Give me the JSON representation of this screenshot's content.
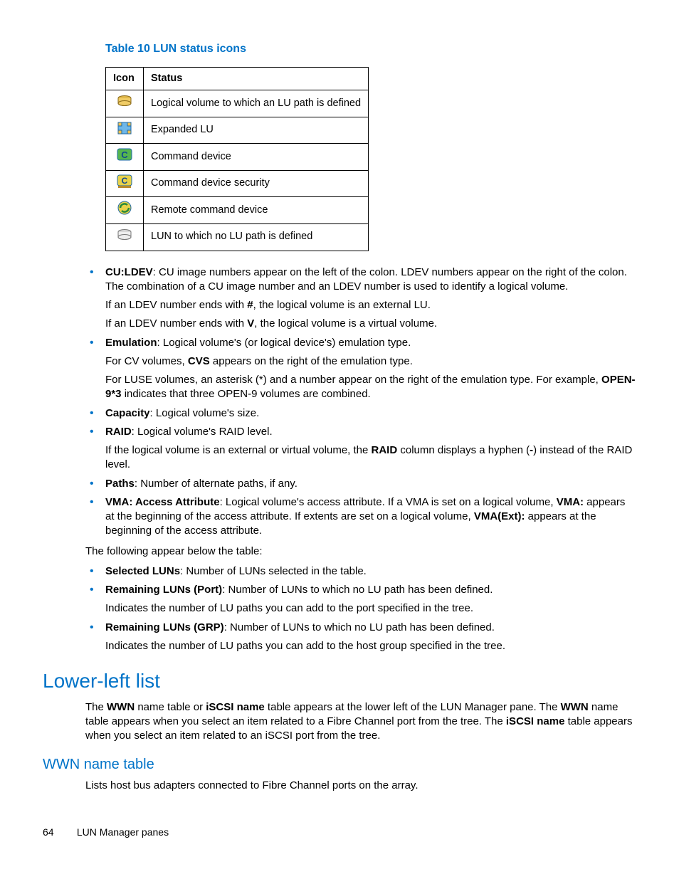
{
  "tableTitle": "Table 10 LUN status icons",
  "tableHeaders": {
    "icon": "Icon",
    "status": "Status"
  },
  "tableRows": [
    {
      "iconName": "lun-defined-icon",
      "status": "Logical volume to which an LU path is defined"
    },
    {
      "iconName": "expanded-lu-icon",
      "status": "Expanded LU"
    },
    {
      "iconName": "command-device-icon",
      "status": "Command device"
    },
    {
      "iconName": "command-device-security-icon",
      "status": "Command device security"
    },
    {
      "iconName": "remote-command-device-icon",
      "status": "Remote command device"
    },
    {
      "iconName": "lun-no-path-icon",
      "status": "LUN to which no LU path is defined"
    }
  ],
  "bullets1": {
    "cu_ldev": {
      "term": "CU:LDEV",
      "text": ": CU image numbers appear on the left of the colon. LDEV numbers appear on the right of the colon. The combination of a CU image number and an LDEV number is used to identify a logical volume.",
      "sub1a": "If an LDEV number ends with ",
      "sub1b": "#",
      "sub1c": ", the logical volume is an external LU.",
      "sub2a": "If an LDEV number ends with ",
      "sub2b": "V",
      "sub2c": ", the logical volume is a virtual volume."
    },
    "emulation": {
      "term": "Emulation",
      "text": ": Logical volume's (or logical device's) emulation type.",
      "sub1a": "For CV volumes, ",
      "sub1b": "CVS",
      "sub1c": " appears on the right of the emulation type.",
      "sub2a": "For LUSE volumes, an asterisk (*) and a number appear on the right of the emulation type. For example, ",
      "sub2b": "OPEN-9*3",
      "sub2c": " indicates that three OPEN-9 volumes are combined."
    },
    "capacity": {
      "term": "Capacity",
      "text": ": Logical volume's size."
    },
    "raid": {
      "term": "RAID",
      "text": ": Logical volume's RAID level.",
      "sub1a": "If the logical volume is an external or virtual volume, the ",
      "sub1b": "RAID",
      "sub1c": " column displays a hyphen (",
      "sub1d": "-",
      "sub1e": ") instead of the RAID level."
    },
    "paths": {
      "term": "Paths",
      "text": ": Number of alternate paths, if any."
    },
    "vma": {
      "term": "VMA: Access Attribute",
      "text_a": ": Logical volume's access attribute. If a VMA is set on a logical volume, ",
      "text_b": "VMA:",
      "text_c": " appears at the beginning of the access attribute. If extents are set on a logical volume, ",
      "text_d": "VMA(Ext):",
      "text_e": " appears at the beginning of the access attribute."
    }
  },
  "belowTablePara": "The following appear below the table:",
  "bullets2": {
    "selected": {
      "term": "Selected LUNs",
      "text": ": Number of LUNs selected in the table."
    },
    "port": {
      "term": "Remaining LUNs (Port)",
      "text": ": Number of LUNs to which no LU path has been defined.",
      "sub": "Indicates the number of LU paths you can add to the port specified in the tree."
    },
    "grp": {
      "term": "Remaining LUNs (GRP)",
      "text": ": Number of LUNs to which no LU path has been defined.",
      "sub": "Indicates the number of LU paths you can add to the host group specified in the tree."
    }
  },
  "section": {
    "title": "Lower-left list",
    "para_a": "The ",
    "para_b": "WWN",
    "para_c": " name table or ",
    "para_d": "iSCSI name",
    "para_e": " table appears at the lower left of the LUN Manager pane. The ",
    "para_f": "WWN",
    "para_g": " name table appears when you select an item related to a Fibre Channel port from the tree. The ",
    "para_h": "iSCSI name",
    "para_i": " table appears when you select an item related to an iSCSI port from the tree."
  },
  "subsection": {
    "title": "WWN name table",
    "para": "Lists host bus adapters connected to Fibre Channel ports on the array."
  },
  "footer": {
    "page": "64",
    "label": "LUN Manager panes"
  }
}
